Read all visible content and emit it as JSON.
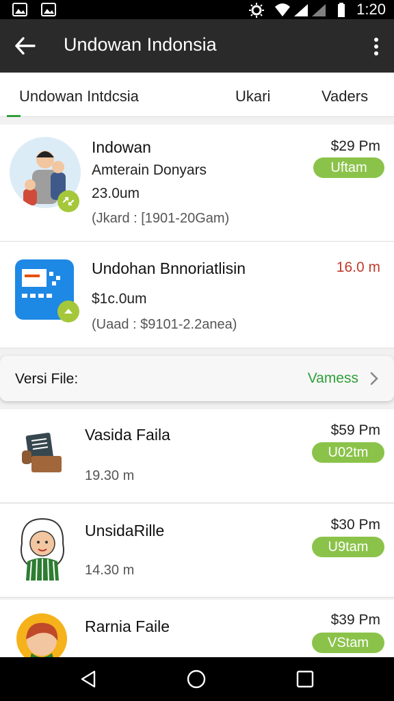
{
  "status_bar": {
    "time": "1:20"
  },
  "app_bar": {
    "title": "Undowan Indonsia"
  },
  "tabs": [
    {
      "label": "Undowan Intdcsia"
    },
    {
      "label": "Ukari"
    },
    {
      "label": "Vaders"
    }
  ],
  "top_items": [
    {
      "name": "Indowan",
      "subtitle": "Amterain Donyars",
      "size": "23.0um",
      "meta": "(Jkard : [1901-20Gam)",
      "price": "$29 Pm",
      "badge": "Uftam"
    },
    {
      "name": "Undohan Bnnoriatlisin",
      "subtitle": "$1c.0um",
      "meta": "(Uaad : $9101-2.2anea)",
      "price": "16.0 m",
      "price_color": "#c0392b"
    }
  ],
  "versi_row": {
    "label": "Versi File:",
    "value": "Vamess"
  },
  "file_items": [
    {
      "name": "Vasida Faila",
      "size": "19.30 m",
      "price": "$59 Pm",
      "badge": "U02tm"
    },
    {
      "name": "UnsidaRille",
      "size": "14.30 m",
      "price": "$30 Pm",
      "badge": "U9tam"
    },
    {
      "name": "Rarnia Faile",
      "price": "$39 Pm",
      "badge": "VStam"
    }
  ],
  "colors": {
    "accent": "#2e9f3a",
    "badge": "#8bc34a",
    "appbar": "#2a2a2a"
  }
}
